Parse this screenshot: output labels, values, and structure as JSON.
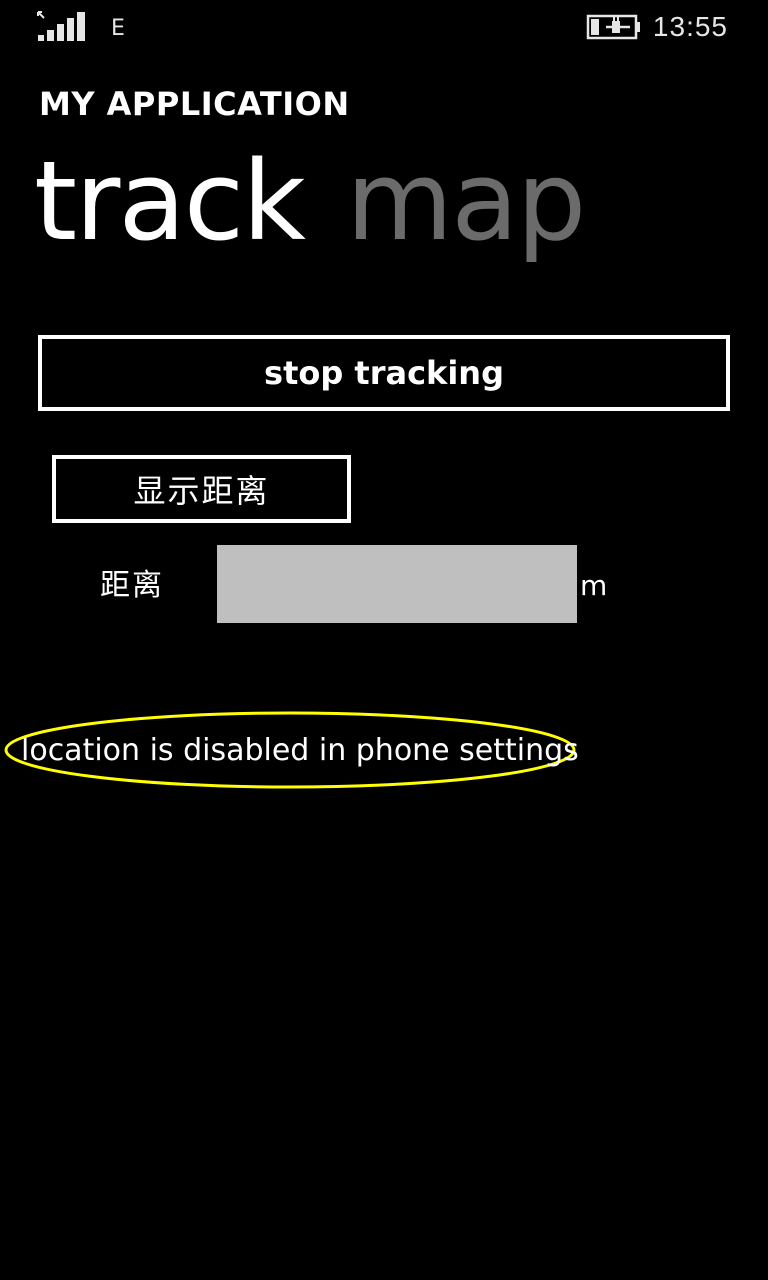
{
  "status_bar": {
    "signal_icon": "cellular-signal-icon",
    "network_type": "E",
    "battery_icon": "battery-charging-icon",
    "time": "13:55"
  },
  "app": {
    "title": "MY APPLICATION"
  },
  "pivot": {
    "items": [
      {
        "label": "track",
        "active": true
      },
      {
        "label": "map",
        "active": false
      }
    ]
  },
  "main": {
    "stop_button_label": "stop tracking",
    "show_distance_button_label": "显示距离",
    "distance_label": "距离",
    "distance_value": "",
    "distance_unit": "m",
    "location_status": "location is disabled in phone settings"
  },
  "colors": {
    "background": "#000000",
    "foreground": "#ffffff",
    "inactive_pivot": "#6b6b6b",
    "input_background": "#bfbfbf",
    "annotation": "#ffff00"
  }
}
